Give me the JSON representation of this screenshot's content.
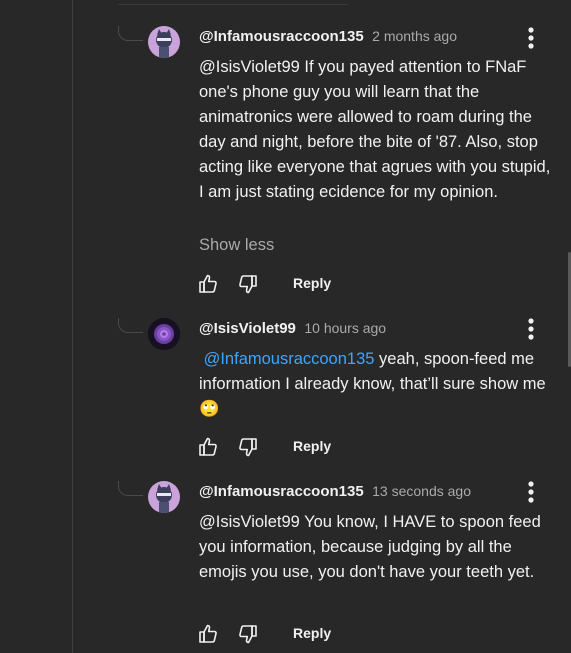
{
  "comments": [
    {
      "author": "@Infamousraccoon135",
      "time": "2 months ago",
      "text": "@IsisViolet99  If you payed attention to FNaF one's phone guy you will learn that the animatronics were allowed to roam during the day and night, before the bite of '87. Also, stop acting like everyone that agrues with you stupid, I am just stating ecidence for my opinion.",
      "show_less": "Show less",
      "reply": "Reply"
    },
    {
      "author": "@IsisViolet99",
      "time": "10 hours ago",
      "mention": "@Infamousraccoon135",
      "text": " yeah, spoon-feed me information I already know, that’ll sure show me",
      "emoji": "🙄",
      "reply": "Reply"
    },
    {
      "author": "@Infamousraccoon135",
      "time": "13 seconds ago",
      "text": "@IsisViolet99 You know, I HAVE to spoon feed you information, because judging by all the emojis you use, you don't have your teeth yet.",
      "reply": "Reply"
    }
  ],
  "icons": {
    "like": "thumbs-up-icon",
    "dislike": "thumbs-down-icon",
    "menu": "more-vertical-icon"
  },
  "colors": {
    "background": "#282828",
    "mention": "#3ea6ff",
    "secondary_text": "#aaaaaa"
  }
}
